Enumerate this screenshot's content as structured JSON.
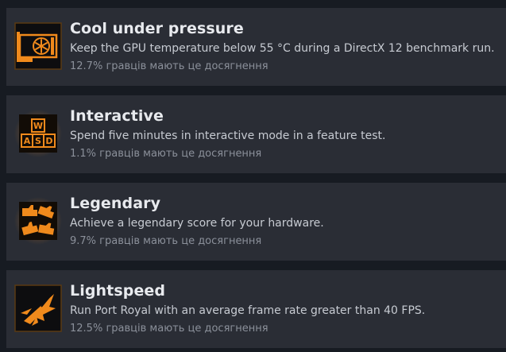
{
  "colors": {
    "background": "#171b22",
    "row_background": "#2a2d35",
    "accent_orange": "#f08a1c",
    "title_text": "#e8eaee",
    "description_text": "#c7cbd2",
    "percent_text": "#8b909a"
  },
  "achievements": [
    {
      "icon": "gpu-snowflake-icon",
      "title": "Cool under pressure",
      "description": "Keep the GPU temperature below 55 °C during a DirectX 12 benchmark run.",
      "percent": "12.7%",
      "percent_suffix": "гравців мають це досягнення"
    },
    {
      "icon": "wasd-keys-icon",
      "title": "Interactive",
      "description": "Spend five minutes in interactive mode in a feature test.",
      "percent": "1.1%",
      "percent_suffix": "гравців мають це досягнення"
    },
    {
      "icon": "thumbs-up-hands-icon",
      "title": "Legendary",
      "description": "Achieve a legendary score for your hardware.",
      "percent": "9.7%",
      "percent_suffix": "гравців мають це досягнення"
    },
    {
      "icon": "spaceship-icon",
      "title": "Lightspeed",
      "description": "Run Port Royal with an average frame rate greater than 40 FPS.",
      "percent": "12.5%",
      "percent_suffix": "гравців мають це досягнення"
    }
  ]
}
